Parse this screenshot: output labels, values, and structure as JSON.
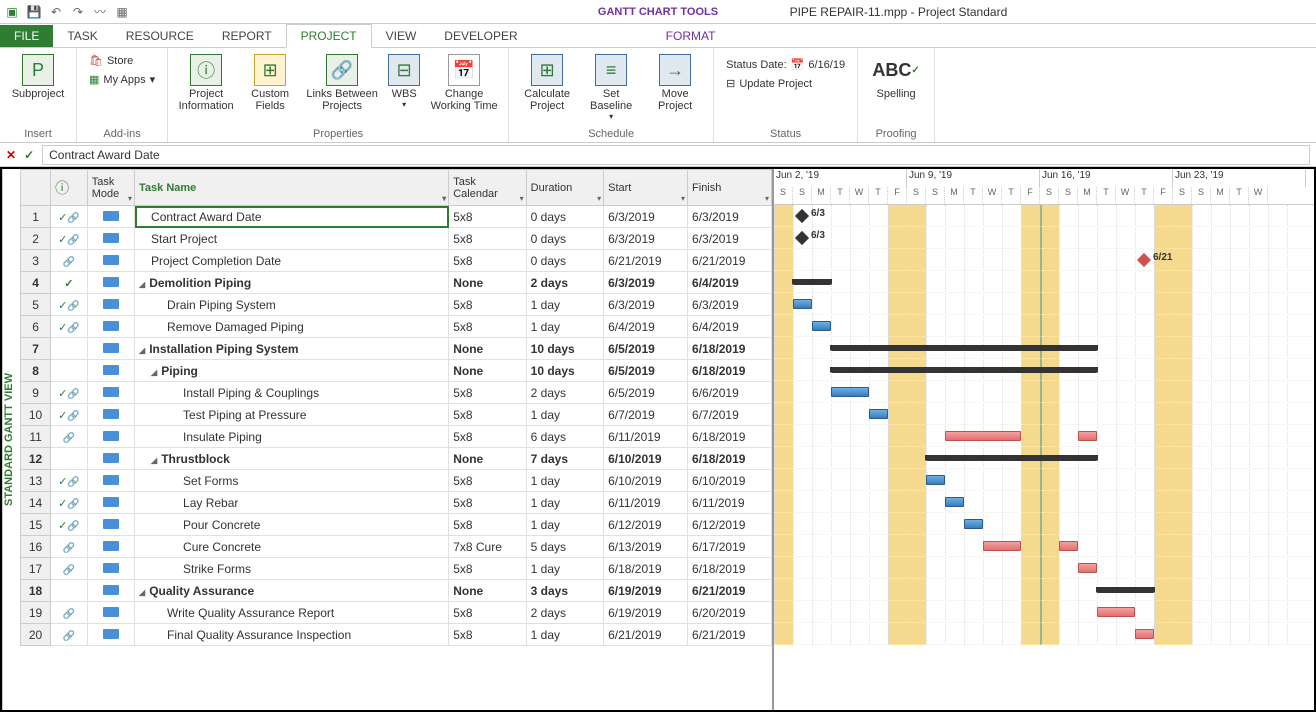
{
  "title": {
    "tools": "GANTT CHART TOOLS",
    "doc": "PIPE REPAIR-11.mpp - Project Standard"
  },
  "tabs": {
    "file": "FILE",
    "task": "TASK",
    "resource": "RESOURCE",
    "report": "REPORT",
    "project": "PROJECT",
    "view": "VIEW",
    "developer": "DEVELOPER",
    "format": "FORMAT"
  },
  "ribbon": {
    "insert": {
      "subproject": "Subproject",
      "label": "Insert"
    },
    "addins": {
      "store": "Store",
      "myapps": "My Apps",
      "label": "Add-ins"
    },
    "props": {
      "info": "Project\nInformation",
      "fields": "Custom\nFields",
      "links": "Links Between\nProjects",
      "wbs": "WBS",
      "cwt": "Change\nWorking Time",
      "label": "Properties"
    },
    "schedule": {
      "calc": "Calculate\nProject",
      "baseline": "Set\nBaseline",
      "move": "Move\nProject",
      "label": "Schedule"
    },
    "status": {
      "date_lbl": "Status Date:",
      "date_val": "6/16/19",
      "update": "Update Project",
      "label": "Status"
    },
    "proofing": {
      "spelling": "Spelling",
      "label": "Proofing"
    }
  },
  "formula": "Contract Award Date",
  "sidebar": "STANDARD GANTT VIEW",
  "headers": {
    "info": "ⓘ",
    "mode": "Task\nMode",
    "name": "Task Name",
    "cal": "Task\nCalendar",
    "dur": "Duration",
    "start": "Start",
    "finish": "Finish"
  },
  "weeks": [
    "Jun 2, '19",
    "Jun 9, '19",
    "Jun 16, '19",
    "Jun 23, '19"
  ],
  "days": [
    "S",
    "S",
    "M",
    "T",
    "W",
    "T",
    "F",
    "S",
    "S",
    "M",
    "T",
    "W",
    "T",
    "F",
    "S",
    "S",
    "M",
    "T",
    "W",
    "T",
    "F",
    "S",
    "S",
    "M",
    "T",
    "W"
  ],
  "tasks": [
    {
      "n": 1,
      "chk": true,
      "link": true,
      "name": "Contract Award Date",
      "ind": 1,
      "cal": "5x8",
      "dur": "0 days",
      "start": "6/3/2019",
      "finish": "6/3/2019",
      "sum": false,
      "ms": true,
      "mday": 1,
      "mlbl": "6/3"
    },
    {
      "n": 2,
      "chk": true,
      "link": true,
      "name": "Start Project",
      "ind": 1,
      "cal": "5x8",
      "dur": "0 days",
      "start": "6/3/2019",
      "finish": "6/3/2019",
      "sum": false,
      "ms": true,
      "mday": 1,
      "mlbl": "6/3"
    },
    {
      "n": 3,
      "chk": false,
      "link": true,
      "name": "Project Completion Date",
      "ind": 1,
      "cal": "5x8",
      "dur": "0 days",
      "start": "6/21/2019",
      "finish": "6/21/2019",
      "sum": false,
      "ms": true,
      "crit": true,
      "mday": 19,
      "mlbl": "6/21"
    },
    {
      "n": 4,
      "chk": true,
      "link": false,
      "name": "Demolition Piping",
      "ind": 0,
      "cal": "None",
      "dur": "2 days",
      "start": "6/3/2019",
      "finish": "6/4/2019",
      "sum": true,
      "sstart": 1,
      "send": 3
    },
    {
      "n": 5,
      "chk": true,
      "link": true,
      "name": "Drain Piping System",
      "ind": 2,
      "cal": "5x8",
      "dur": "1 day",
      "start": "6/3/2019",
      "finish": "6/3/2019",
      "sum": false,
      "bstart": 1,
      "bend": 2
    },
    {
      "n": 6,
      "chk": true,
      "link": true,
      "name": "Remove Damaged Piping",
      "ind": 2,
      "cal": "5x8",
      "dur": "1 day",
      "start": "6/4/2019",
      "finish": "6/4/2019",
      "sum": false,
      "bstart": 2,
      "bend": 3
    },
    {
      "n": 7,
      "chk": false,
      "link": false,
      "name": "Installation Piping System",
      "ind": 0,
      "cal": "None",
      "dur": "10 days",
      "start": "6/5/2019",
      "finish": "6/18/2019",
      "sum": true,
      "sstart": 3,
      "send": 17
    },
    {
      "n": 8,
      "chk": false,
      "link": false,
      "name": "Piping",
      "ind": 1,
      "cal": "None",
      "dur": "10 days",
      "start": "6/5/2019",
      "finish": "6/18/2019",
      "sum": true,
      "sstart": 3,
      "send": 17
    },
    {
      "n": 9,
      "chk": true,
      "link": true,
      "name": "Install Piping & Couplings",
      "ind": 3,
      "cal": "5x8",
      "dur": "2 days",
      "start": "6/5/2019",
      "finish": "6/6/2019",
      "sum": false,
      "bstart": 3,
      "bend": 5
    },
    {
      "n": 10,
      "chk": true,
      "link": true,
      "name": "Test Piping at Pressure",
      "ind": 3,
      "cal": "5x8",
      "dur": "1 day",
      "start": "6/7/2019",
      "finish": "6/7/2019",
      "sum": false,
      "bstart": 5,
      "bend": 6
    },
    {
      "n": 11,
      "chk": false,
      "link": true,
      "name": "Insulate Piping",
      "ind": 3,
      "cal": "5x8",
      "dur": "6 days",
      "start": "6/11/2019",
      "finish": "6/18/2019",
      "sum": false,
      "crit": true,
      "bstart": 9,
      "bend": 17,
      "split": [
        9,
        13,
        16,
        17
      ]
    },
    {
      "n": 12,
      "chk": false,
      "link": false,
      "name": "Thrustblock",
      "ind": 1,
      "cal": "None",
      "dur": "7 days",
      "start": "6/10/2019",
      "finish": "6/18/2019",
      "sum": true,
      "sstart": 8,
      "send": 17
    },
    {
      "n": 13,
      "chk": true,
      "link": true,
      "name": "Set Forms",
      "ind": 3,
      "cal": "5x8",
      "dur": "1 day",
      "start": "6/10/2019",
      "finish": "6/10/2019",
      "sum": false,
      "bstart": 8,
      "bend": 9
    },
    {
      "n": 14,
      "chk": true,
      "link": true,
      "name": "Lay Rebar",
      "ind": 3,
      "cal": "5x8",
      "dur": "1 day",
      "start": "6/11/2019",
      "finish": "6/11/2019",
      "sum": false,
      "bstart": 9,
      "bend": 10
    },
    {
      "n": 15,
      "chk": true,
      "link": true,
      "name": "Pour Concrete",
      "ind": 3,
      "cal": "5x8",
      "dur": "1 day",
      "start": "6/12/2019",
      "finish": "6/12/2019",
      "sum": false,
      "bstart": 10,
      "bend": 11
    },
    {
      "n": 16,
      "chk": false,
      "link": true,
      "name": "Cure Concrete",
      "ind": 3,
      "cal": "7x8 Cure",
      "dur": "5 days",
      "start": "6/13/2019",
      "finish": "6/17/2019",
      "sum": false,
      "crit": true,
      "bstart": 11,
      "bend": 16,
      "split": [
        11,
        13,
        15,
        16
      ]
    },
    {
      "n": 17,
      "chk": false,
      "link": true,
      "name": "Strike Forms",
      "ind": 3,
      "cal": "5x8",
      "dur": "1 day",
      "start": "6/18/2019",
      "finish": "6/18/2019",
      "sum": false,
      "crit": true,
      "bstart": 16,
      "bend": 17
    },
    {
      "n": 18,
      "chk": false,
      "link": false,
      "name": "Quality Assurance",
      "ind": 0,
      "cal": "None",
      "dur": "3 days",
      "start": "6/19/2019",
      "finish": "6/21/2019",
      "sum": true,
      "sstart": 17,
      "send": 20
    },
    {
      "n": 19,
      "chk": false,
      "link": true,
      "name": "Write Quality Assurance Report",
      "ind": 2,
      "cal": "5x8",
      "dur": "2 days",
      "start": "6/19/2019",
      "finish": "6/20/2019",
      "sum": false,
      "crit": true,
      "bstart": 17,
      "bend": 19
    },
    {
      "n": 20,
      "chk": false,
      "link": true,
      "name": "Final Quality Assurance Inspection",
      "ind": 2,
      "cal": "5x8",
      "dur": "1 day",
      "start": "6/21/2019",
      "finish": "6/21/2019",
      "sum": false,
      "crit": true,
      "bstart": 19,
      "bend": 20
    }
  ]
}
